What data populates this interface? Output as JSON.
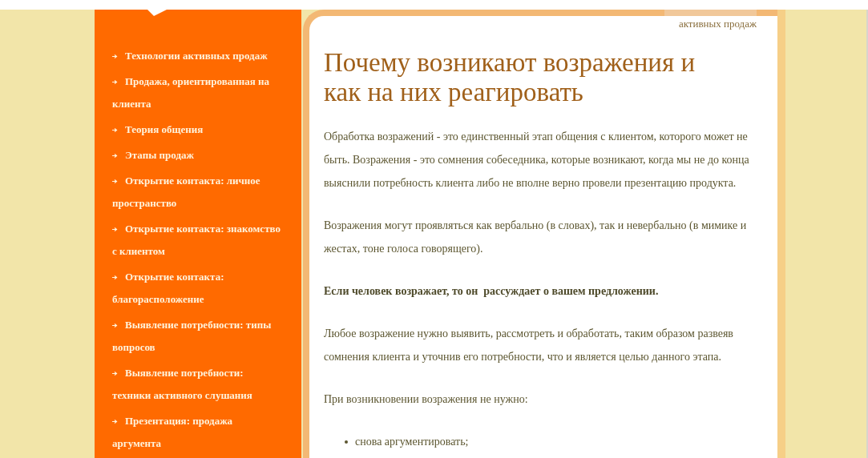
{
  "sidebar": {
    "items": [
      {
        "label": "Технологии активных продаж"
      },
      {
        "label": "Продажа, ориентированная на клиента"
      },
      {
        "label": "Теория общения"
      },
      {
        "label": "Этапы продаж"
      },
      {
        "label": "Открытие контакта: личное пространство"
      },
      {
        "label": "Открытие контакта: знакомство с клиентом"
      },
      {
        "label": "Открытие контакта: благорасположение"
      },
      {
        "label": "Выявление потребности: типы вопросов"
      },
      {
        "label": "Выявление потребности: техники активного слушания"
      },
      {
        "label": "Презентация: продажа аргумента"
      }
    ]
  },
  "breadcrumb": "активных продаж",
  "article": {
    "title": "Почему возникают возражения и как на них реагировать",
    "blocks": [
      {
        "kind": "paragraph",
        "text": "Обработка возражений - это единственный этап общения с клиентом, которого может не быть. Возражения - это сомнения собеседника, которые возникают, когда мы не до конца выяснили потребность клиента либо не вполне верно провели презентацию продукта."
      },
      {
        "kind": "paragraph",
        "text": "Возражения могут проявляться как вербально (в словах), так и невербально (в мимике и жестах, тоне голоса говорящего)."
      },
      {
        "kind": "strong",
        "text": "Если человек возражает, то он  рассуждает о вашем предложении."
      },
      {
        "kind": "paragraph",
        "text": "Любое возражение нужно выявить, рассмотреть и обработать, таким образом развеяв сомнения клиента и уточнив его потребности, что и является целью данного этапа."
      },
      {
        "kind": "paragraph",
        "text": "При возникновении возражения не нужно:"
      },
      {
        "kind": "list",
        "items": [
          "снова аргументировать;"
        ]
      }
    ]
  }
}
